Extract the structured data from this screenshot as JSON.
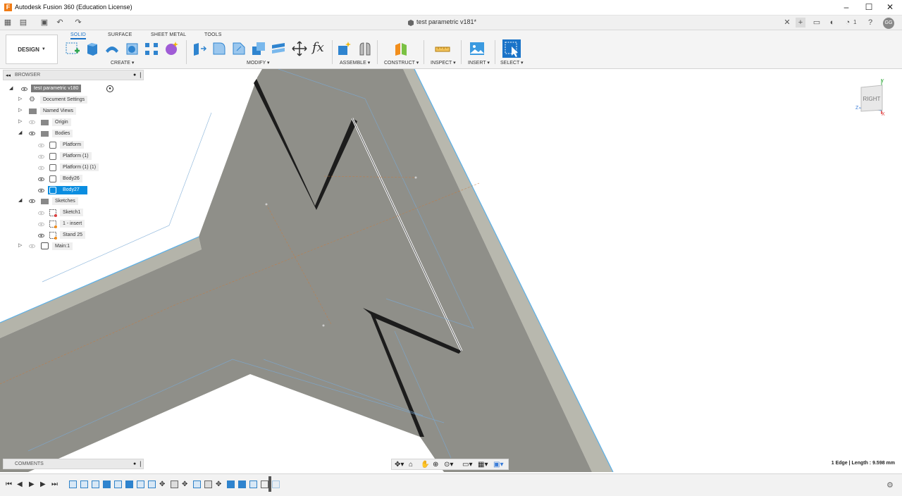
{
  "app": {
    "title": "Autodesk Fusion 360 (Education License)",
    "logo_letter": "F"
  },
  "document_tab": {
    "label": "test parametric v181*"
  },
  "user": {
    "initials": "GG",
    "jobs_count": "1"
  },
  "workspace": {
    "switcher_label": "DESIGN"
  },
  "tabs": [
    "SOLID",
    "SURFACE",
    "SHEET METAL",
    "TOOLS"
  ],
  "active_tab": "SOLID",
  "groups": {
    "create": "CREATE",
    "modify": "MODIFY",
    "assemble": "ASSEMBLE",
    "construct": "CONSTRUCT",
    "inspect": "INSPECT",
    "insert": "INSERT",
    "select": "SELECT"
  },
  "browser": {
    "header": "BROWSER",
    "root": "test parametric v180",
    "items": {
      "doc_settings": "Document Settings",
      "named_views": "Named Views",
      "origin": "Origin",
      "bodies": "Bodies",
      "sketches": "Sketches",
      "main": "Main:1"
    },
    "bodies": [
      "Platform",
      "Platform (1)",
      "Platform (1) (1)",
      "Body26",
      "Body27"
    ],
    "selected_body": "Body27",
    "sketches": [
      "Sketch1",
      "1 - insert",
      "Stand 25"
    ]
  },
  "comments": {
    "header": "COMMENTS"
  },
  "status": {
    "selection": "1 Edge | Length : 9.598 mm"
  },
  "viewcube": {
    "face": "RIGHT",
    "axis_y": "Y",
    "axis_z": "Z",
    "axis_x": "X"
  },
  "colors": {
    "accent": "#0a8de0",
    "model_face": "#8f8f89",
    "model_side": "#b4b4aa",
    "selection": "#ffffff"
  }
}
